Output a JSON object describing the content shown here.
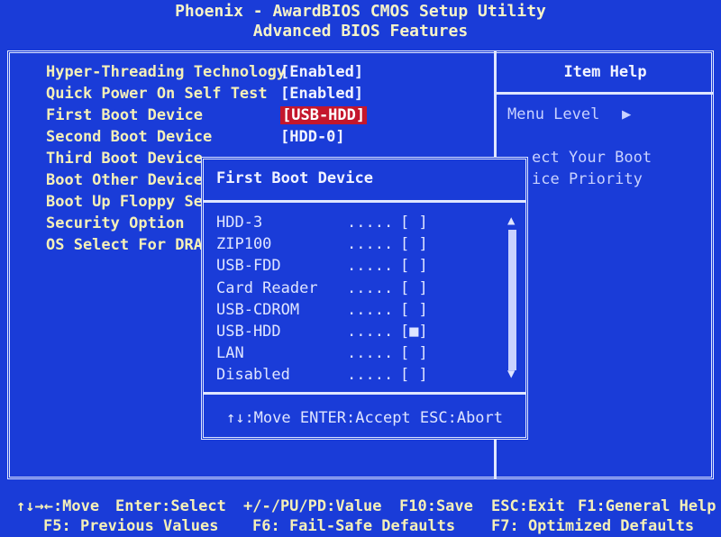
{
  "header": {
    "title": "Phoenix - AwardBIOS CMOS Setup Utility",
    "subtitle": "Advanced BIOS Features"
  },
  "settings": [
    {
      "label": "Hyper-Threading Technology",
      "value": "[Enabled]"
    },
    {
      "label": "Quick Power On Self Test",
      "value": "[Enabled]"
    },
    {
      "label": "First Boot Device",
      "value": "[USB-HDD]"
    },
    {
      "label": "Second Boot Device",
      "value": "[HDD-0]"
    },
    {
      "label": "Third Boot Device",
      "value": ""
    },
    {
      "label": "Boot Other Device",
      "value": ""
    },
    {
      "label": "Boot Up Floppy Se",
      "value": ""
    },
    {
      "label": "Security Option",
      "value": ""
    },
    {
      "label": "OS Select For DRA",
      "value": ""
    }
  ],
  "help": {
    "title": "Item Help",
    "menu_level": "Menu Level",
    "menu_level_arrow": "▶",
    "lines": [
      "ect Your Boot",
      "ice Priority"
    ]
  },
  "popup": {
    "title": "First Boot Device",
    "options": [
      {
        "name": "HDD-3",
        "dots": ".....",
        "box": "[ ]"
      },
      {
        "name": "ZIP100",
        "dots": ".....",
        "box": "[ ]"
      },
      {
        "name": "USB-FDD",
        "dots": ".....",
        "box": "[ ]"
      },
      {
        "name": "Card Reader",
        "dots": ".....",
        "box": "[ ]"
      },
      {
        "name": "USB-CDROM",
        "dots": ".....",
        "box": "[ ]"
      },
      {
        "name": "USB-HDD",
        "dots": ".....",
        "box": "[■]"
      },
      {
        "name": "LAN",
        "dots": ".....",
        "box": "[ ]"
      },
      {
        "name": "Disabled",
        "dots": ".....",
        "box": "[ ]"
      }
    ],
    "scroll_up": "▲",
    "scroll_down": "▼",
    "hint": "↑↓:Move ENTER:Accept ESC:Abort"
  },
  "footer": {
    "row1": [
      "↑↓→←:Move",
      "Enter:Select",
      "+/-/PU/PD:Value",
      "F10:Save",
      "ESC:Exit",
      "F1:General Help"
    ],
    "row2": [
      "F5: Previous Values",
      "F6: Fail-Safe Defaults",
      "F7: Optimized Defaults"
    ]
  },
  "colors": {
    "background": "#1a3cd8",
    "highlight": "#c4162c",
    "option_text": "#f5f0b8",
    "frame": "#dfe6ff"
  }
}
